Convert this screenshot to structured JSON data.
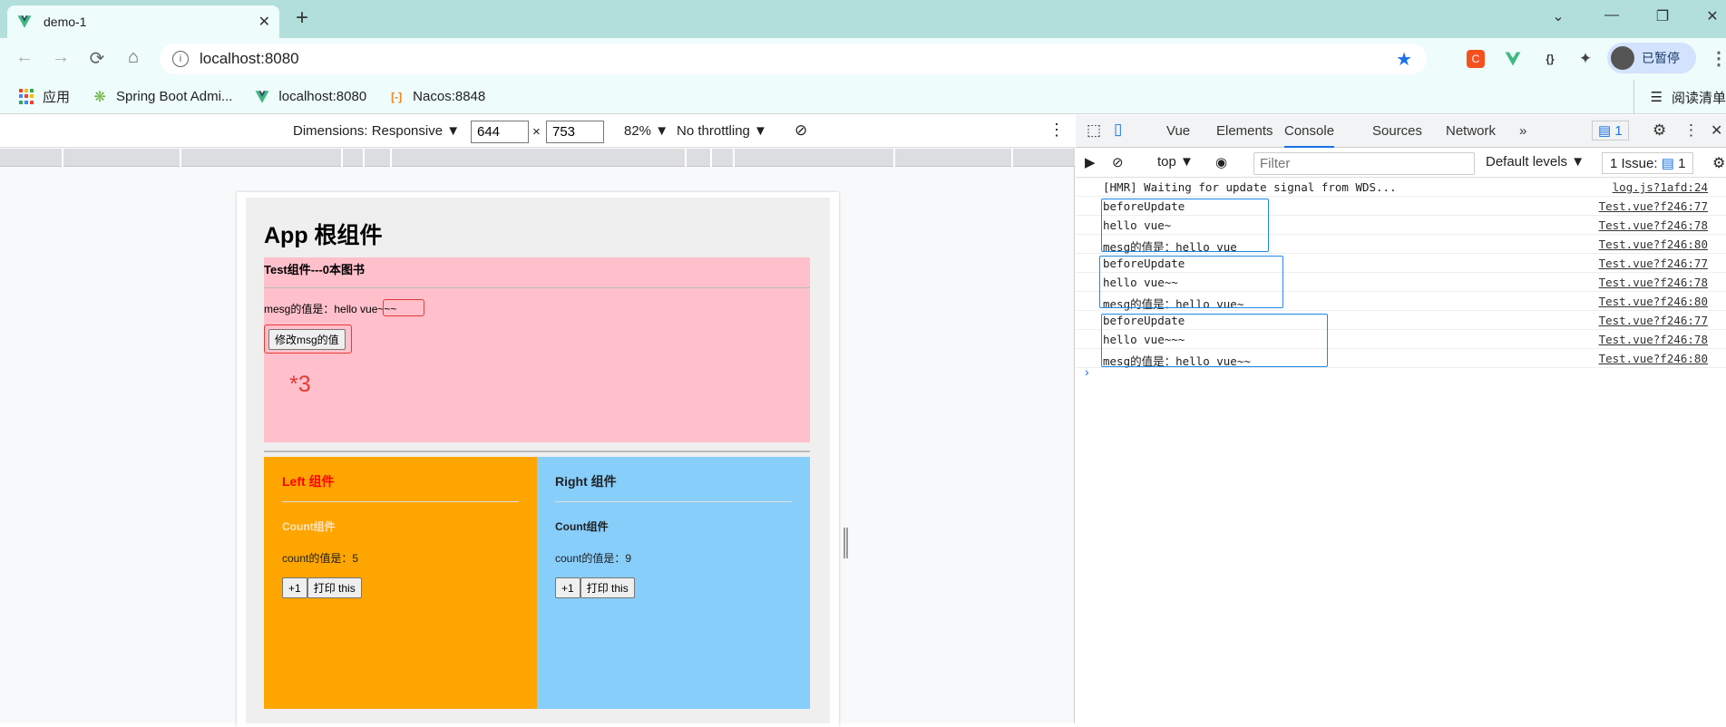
{
  "browser": {
    "tab_title": "demo-1",
    "close_glyph": "✕",
    "newtab_glyph": "+",
    "win": {
      "min": "—",
      "max": "❐",
      "close": "✕",
      "chev": "⌄"
    },
    "nav": {
      "back": "←",
      "forward": "→",
      "reload": "⟳",
      "home": "⌂"
    },
    "url": "localhost:8080",
    "profile_label": "已暂停",
    "menu_glyph": "⋮",
    "bookmarks": [
      {
        "label": "应用",
        "icon": "apps-icon"
      },
      {
        "label": "Spring Boot Admi...",
        "icon": "spring-icon"
      },
      {
        "label": "localhost:8080",
        "icon": "vue-icon"
      },
      {
        "label": "Nacos:8848",
        "icon": "nacos-icon"
      }
    ],
    "reading_list": "阅读清单"
  },
  "device_toolbar": {
    "dimensions": "Dimensions: Responsive ▼",
    "width": "644",
    "times": "×",
    "height": "753",
    "zoom": "82% ▼",
    "throttle": "No throttling ▼"
  },
  "page": {
    "title": "App 根组件",
    "test": {
      "heading": "Test组件---0本图书",
      "msg_text": "mesg的值是：hello vue~~~",
      "button": "修改msg的值",
      "annotation": "*3"
    },
    "left": {
      "heading": "Left 组件",
      "count_title": "Count组件",
      "count_text": "count的值是：5",
      "plus": "+1",
      "print": "打印 this"
    },
    "right": {
      "heading": "Right 组件",
      "count_title": "Count组件",
      "count_text": "count的值是：9",
      "plus": "+1",
      "print": "打印 this"
    }
  },
  "devtools": {
    "tabs": [
      "Vue",
      "Elements",
      "Console",
      "Sources",
      "Network",
      "»"
    ],
    "message_badge": "1",
    "context": "top ▼",
    "filter_placeholder": "Filter",
    "levels": "Default levels ▼",
    "issues": "1 Issue: ",
    "issues_badge": "1",
    "prompt": "›",
    "logs": [
      {
        "msg": "[HMR] Waiting for update signal from WDS...",
        "src": "log.js?1afd:24"
      },
      {
        "msg": "beforeUpdate",
        "src": "Test.vue?f246:77"
      },
      {
        "msg": "hello vue~",
        "src": "Test.vue?f246:78"
      },
      {
        "msg": "mesg的值是：hello vue",
        "src": "Test.vue?f246:80"
      },
      {
        "msg": "beforeUpdate",
        "src": "Test.vue?f246:77"
      },
      {
        "msg": "hello vue~~",
        "src": "Test.vue?f246:78"
      },
      {
        "msg": "mesg的值是：hello vue~",
        "src": "Test.vue?f246:80"
      },
      {
        "msg": "beforeUpdate",
        "src": "Test.vue?f246:77"
      },
      {
        "msg": "hello vue~~~",
        "src": "Test.vue?f246:78"
      },
      {
        "msg": "mesg的值是：hello vue~~",
        "src": "Test.vue?f246:80"
      }
    ]
  },
  "colors": {
    "accent": "#1a73e8",
    "annotation": "#e53935",
    "pink": "#ffc0cb",
    "orange": "#ffa500",
    "skyblue": "#87cefa"
  }
}
